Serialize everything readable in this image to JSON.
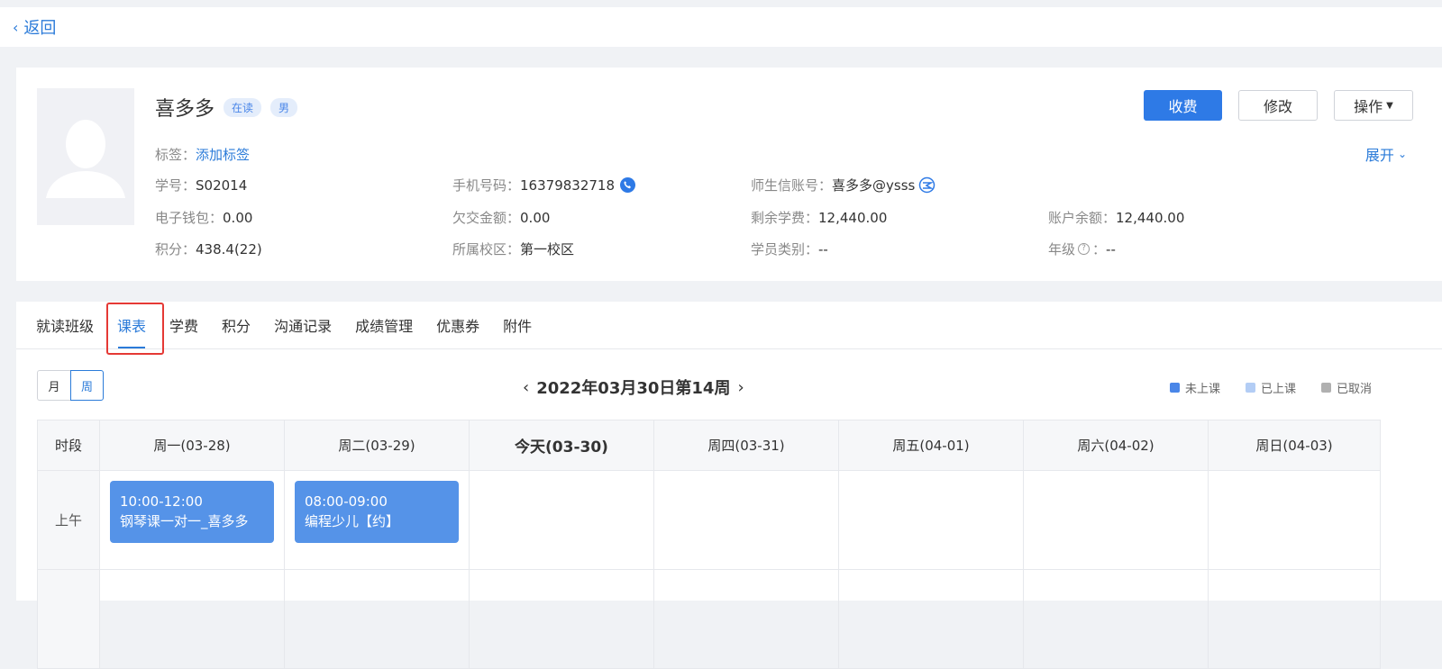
{
  "topbar": {
    "back_label": "返回"
  },
  "profile": {
    "name": "喜多多",
    "badges": [
      "在读",
      "男"
    ],
    "buttons": {
      "charge": "收费",
      "edit": "修改",
      "operate": "操作"
    },
    "expand_label": "展开",
    "tags_label": "标签：",
    "tags_link": "添加标签",
    "fields": {
      "student_no": {
        "label": "学号：",
        "value": "S02014"
      },
      "phone": {
        "label": "手机号码：",
        "value": "16379832718"
      },
      "account": {
        "label": "师生信账号：",
        "value": "喜多多@ysss"
      },
      "wallet": {
        "label": "电子钱包：",
        "value": "0.00"
      },
      "arrears": {
        "label": "欠交金额：",
        "value": "0.00"
      },
      "remaining_fee": {
        "label": "剩余学费：",
        "value": "12,440.00"
      },
      "balance": {
        "label": "账户余额：",
        "value": "12,440.00"
      },
      "points": {
        "label": "积分：",
        "value": "438.4(22)"
      },
      "campus": {
        "label": "所属校区：",
        "value": "第一校区"
      },
      "category": {
        "label": "学员类别：",
        "value": "--"
      },
      "grade": {
        "label": "年级",
        "value": "--"
      }
    }
  },
  "tabs": [
    {
      "label": "就读班级",
      "active": false
    },
    {
      "label": "课表",
      "active": true
    },
    {
      "label": "学费",
      "active": false
    },
    {
      "label": "积分",
      "active": false
    },
    {
      "label": "沟通记录",
      "active": false
    },
    {
      "label": "成绩管理",
      "active": false
    },
    {
      "label": "优惠券",
      "active": false
    },
    {
      "label": "附件",
      "active": false
    }
  ],
  "schedule": {
    "view_month": "月",
    "view_week": "周",
    "view_selected": "周",
    "week_title": "2022年03月30日第14周",
    "legend": [
      {
        "label": "未上课",
        "color": "#4a86e8"
      },
      {
        "label": "已上课",
        "color": "#b3cdf5"
      },
      {
        "label": "已取消",
        "color": "#b0b0b0"
      }
    ],
    "slot_header": "时段",
    "days": [
      "周一(03-28)",
      "周二(03-29)",
      "今天(03-30)",
      "周四(03-31)",
      "周五(04-01)",
      "周六(04-02)",
      "周日(04-03)"
    ],
    "slots": [
      "上午",
      ""
    ],
    "events": [
      {
        "time": "10:00-12:00",
        "title": "钢琴课一对一_喜多多"
      },
      {
        "time": "08:00-09:00",
        "title": "编程少儿【约】"
      }
    ]
  },
  "colors": {
    "accent": "#2b7bd9",
    "primary_button": "#2e7ae6",
    "event": "#5593e8",
    "highlight": "#e53935"
  }
}
